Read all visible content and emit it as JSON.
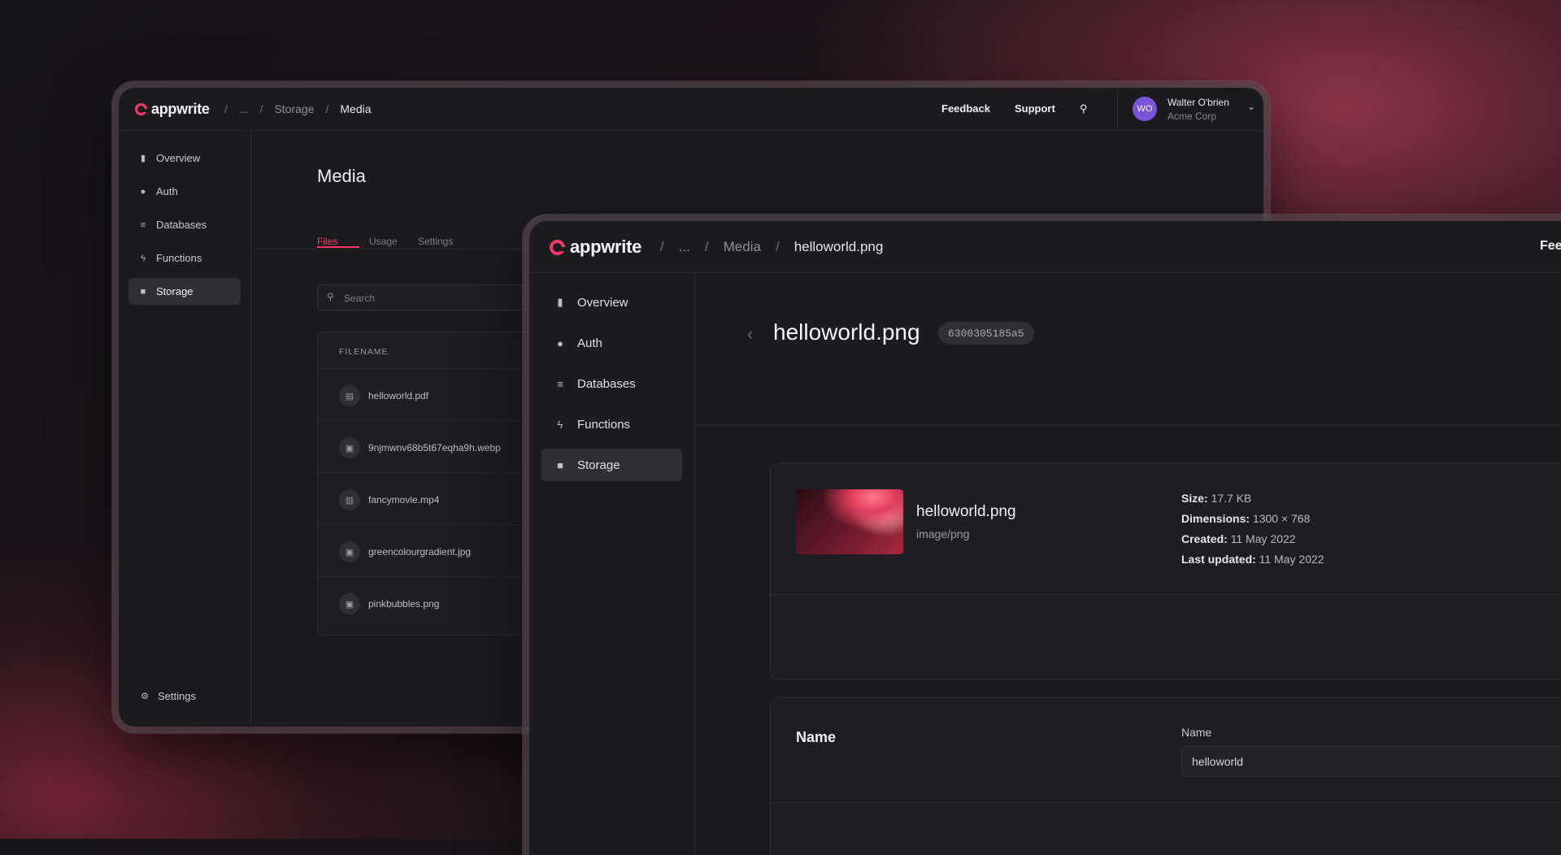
{
  "back_window": {
    "logo": "appwrite",
    "breadcrumb": [
      "...",
      "Storage",
      "Media"
    ],
    "header": {
      "feedback": "Feedback",
      "support": "Support"
    },
    "user": {
      "initials": "WO",
      "name": "Walter O'brien",
      "org": "Acme Corp"
    },
    "nav": [
      {
        "label": "Overview",
        "icon": "bar-chart-icon"
      },
      {
        "label": "Auth",
        "icon": "users-icon"
      },
      {
        "label": "Databases",
        "icon": "database-icon"
      },
      {
        "label": "Functions",
        "icon": "lightning-icon"
      },
      {
        "label": "Storage",
        "icon": "folder-icon",
        "active": true
      }
    ],
    "settings": "Settings",
    "page_title": "Media",
    "tabs": [
      "Files",
      "Usage",
      "Settings"
    ],
    "active_tab": "Files",
    "search_placeholder": "Search",
    "table_header": "FILENAME",
    "files": [
      {
        "name": "helloworld.pdf",
        "icon": "document-icon"
      },
      {
        "name": "9njmwnv68b5t67eqha9h.webp",
        "icon": "image-icon"
      },
      {
        "name": "fancymovie.mp4",
        "icon": "film-icon"
      },
      {
        "name": "greencolourgradient.jpg",
        "icon": "image-icon"
      },
      {
        "name": "pinkbubbles.png",
        "icon": "image-icon"
      }
    ]
  },
  "front_window": {
    "logo": "appwrite",
    "breadcrumb": [
      "...",
      "Media",
      "helloworld.png"
    ],
    "header_feedback_partial": "Feed",
    "nav": [
      {
        "label": "Overview",
        "icon": "bar-chart-icon"
      },
      {
        "label": "Auth",
        "icon": "users-icon"
      },
      {
        "label": "Databases",
        "icon": "database-icon"
      },
      {
        "label": "Functions",
        "icon": "lightning-icon"
      },
      {
        "label": "Storage",
        "icon": "folder-icon",
        "active": true
      }
    ],
    "file_title": "helloworld.png",
    "file_id": "6300305185a5",
    "file_card": {
      "name": "helloworld.png",
      "type": "image/png",
      "size_label": "Size:",
      "size": "17.7 KB",
      "dimensions_label": "Dimensions:",
      "dimensions": "1300 × 768",
      "created_label": "Created:",
      "created": "11 May 2022",
      "updated_label": "Last updated:",
      "updated": "11 May 2022"
    },
    "name_card": {
      "title": "Name",
      "field_label": "Name",
      "field_value": "helloworld"
    }
  },
  "colors": {
    "accent": "#fd366e",
    "avatar": "#7a53d6"
  }
}
